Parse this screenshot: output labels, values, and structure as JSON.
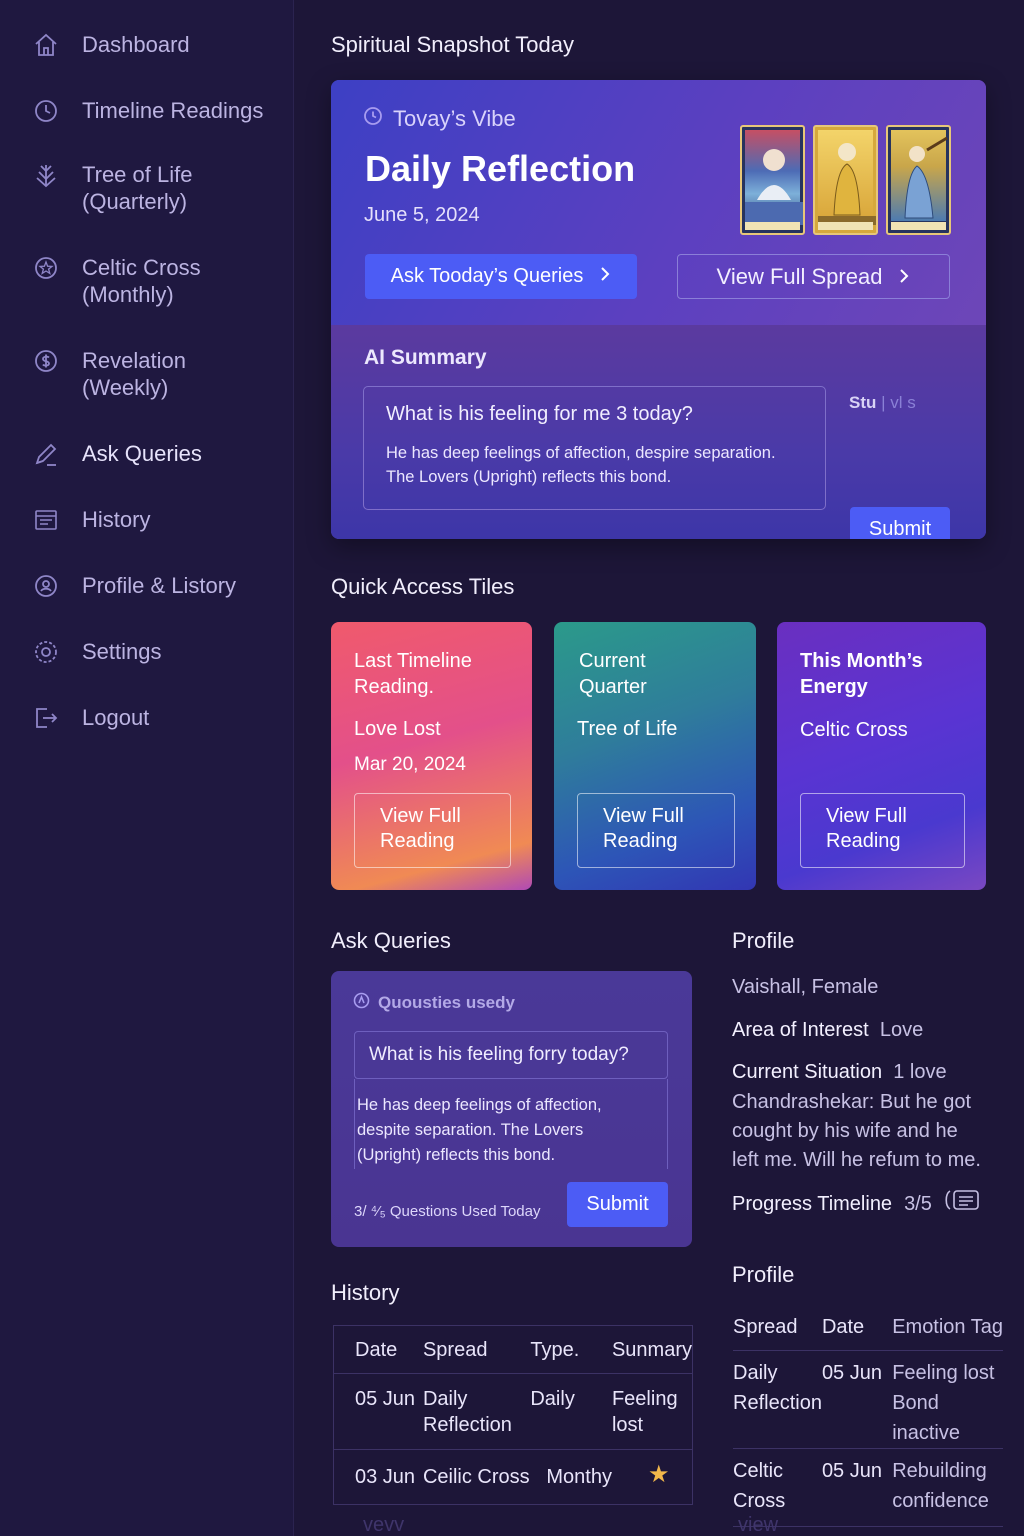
{
  "sidebar": {
    "items": [
      {
        "label": "Dashboard",
        "icon": "home-icon"
      },
      {
        "label": "Timeline Readings",
        "icon": "clock-icon"
      },
      {
        "label": "Tree of Life\n(Quarterly)",
        "icon": "tree-arrow-icon"
      },
      {
        "label": "Celtic Cross\n(Monthly)",
        "icon": "star-circle-icon"
      },
      {
        "label": "Revelation\n(Weekly)",
        "icon": "dollar-circle-icon"
      },
      {
        "label": "Ask Queries",
        "icon": "pencil-icon"
      },
      {
        "label": "History",
        "icon": "history-calendar-icon"
      },
      {
        "label": "Profile & Listory",
        "icon": "profile-coin-icon"
      },
      {
        "label": "Settings",
        "icon": "gear-icon"
      },
      {
        "label": "Logout",
        "icon": "logout-icon"
      }
    ]
  },
  "snapshot": {
    "section_title": "Spiritual Snapshot Today",
    "vibe_label": "Tovay’s Vibe",
    "title": "Daily Reflection",
    "date": "June 5, 2024",
    "ask_button": "Ask Tooday’s Queries",
    "spread_button": "View Full Spread",
    "ai_title": "AI Summary",
    "question": "What is his feeling for me 3 today?",
    "answer": "He has deep feelings of affection, despire separation.\nThe Lovers (Upright) reflects this bond.",
    "status_a": "Stu",
    "status_b": "| vl s",
    "submit": "Submit"
  },
  "tiles": {
    "section_title": "Quick Access Tiles",
    "items": [
      {
        "title": "Last Timeline\nReading.",
        "subtitle": "Love Lost",
        "date": "Mar 20, 2024",
        "button": "View Full\nReading"
      },
      {
        "title": "Current\nQuarter",
        "subtitle": "Tree of Life",
        "date": "",
        "button": "View Full\nReading"
      },
      {
        "title": "This Month’s\nEnergy",
        "subtitle": "Celtic Cross",
        "date": "",
        "button": "View Full\nReading"
      }
    ]
  },
  "ask": {
    "section_title": "Ask Queries",
    "header": "Quousties usedy",
    "question": "What is his feeling forry today?",
    "answer": "He has deep feelings of affection,\ndespite separation. The Lovers\n(Upright) reflects this bond.",
    "used": "3/ ⁴⁄₅ Questions Used Today",
    "submit": "Submit"
  },
  "profile": {
    "section_title": "Profile",
    "name": "Vaishall, Female",
    "interest_label": "Area of Interest",
    "interest_value": "Love",
    "situation_label": "Current Situation",
    "situation_value": "1 love",
    "situation_text": "Chandrashekar: But he got cought by his wife and he left me. Will he refum to me.",
    "progress_label": "Progress Timeline",
    "progress_value": "3/5"
  },
  "history": {
    "section_title": "History",
    "columns": [
      "Date",
      "Spread",
      "Type.",
      "Sunmary"
    ],
    "rows": [
      [
        "05 Jun",
        "Daily\nReflection",
        "Daily",
        "Feeling\nlost"
      ],
      [
        "03 Jun",
        "Ceilic Cross",
        "Monthy",
        "★"
      ]
    ],
    "more": "vevv"
  },
  "profile_table": {
    "section_title": "Profile",
    "columns": [
      "Spread",
      "Date",
      "Emotion Tag"
    ],
    "rows": [
      [
        "Daily\nReflection",
        "05 Jun",
        "Feeling lost\nBond inactive"
      ],
      [
        "Celtic\nCross",
        "05 Jun",
        "Rebuilding\nconfidence"
      ]
    ],
    "more": "view"
  },
  "colors": {
    "background": "#1d1638",
    "sidebar": "#1f1840",
    "accent": "#4c5cf5",
    "star": "#f2b84b"
  }
}
